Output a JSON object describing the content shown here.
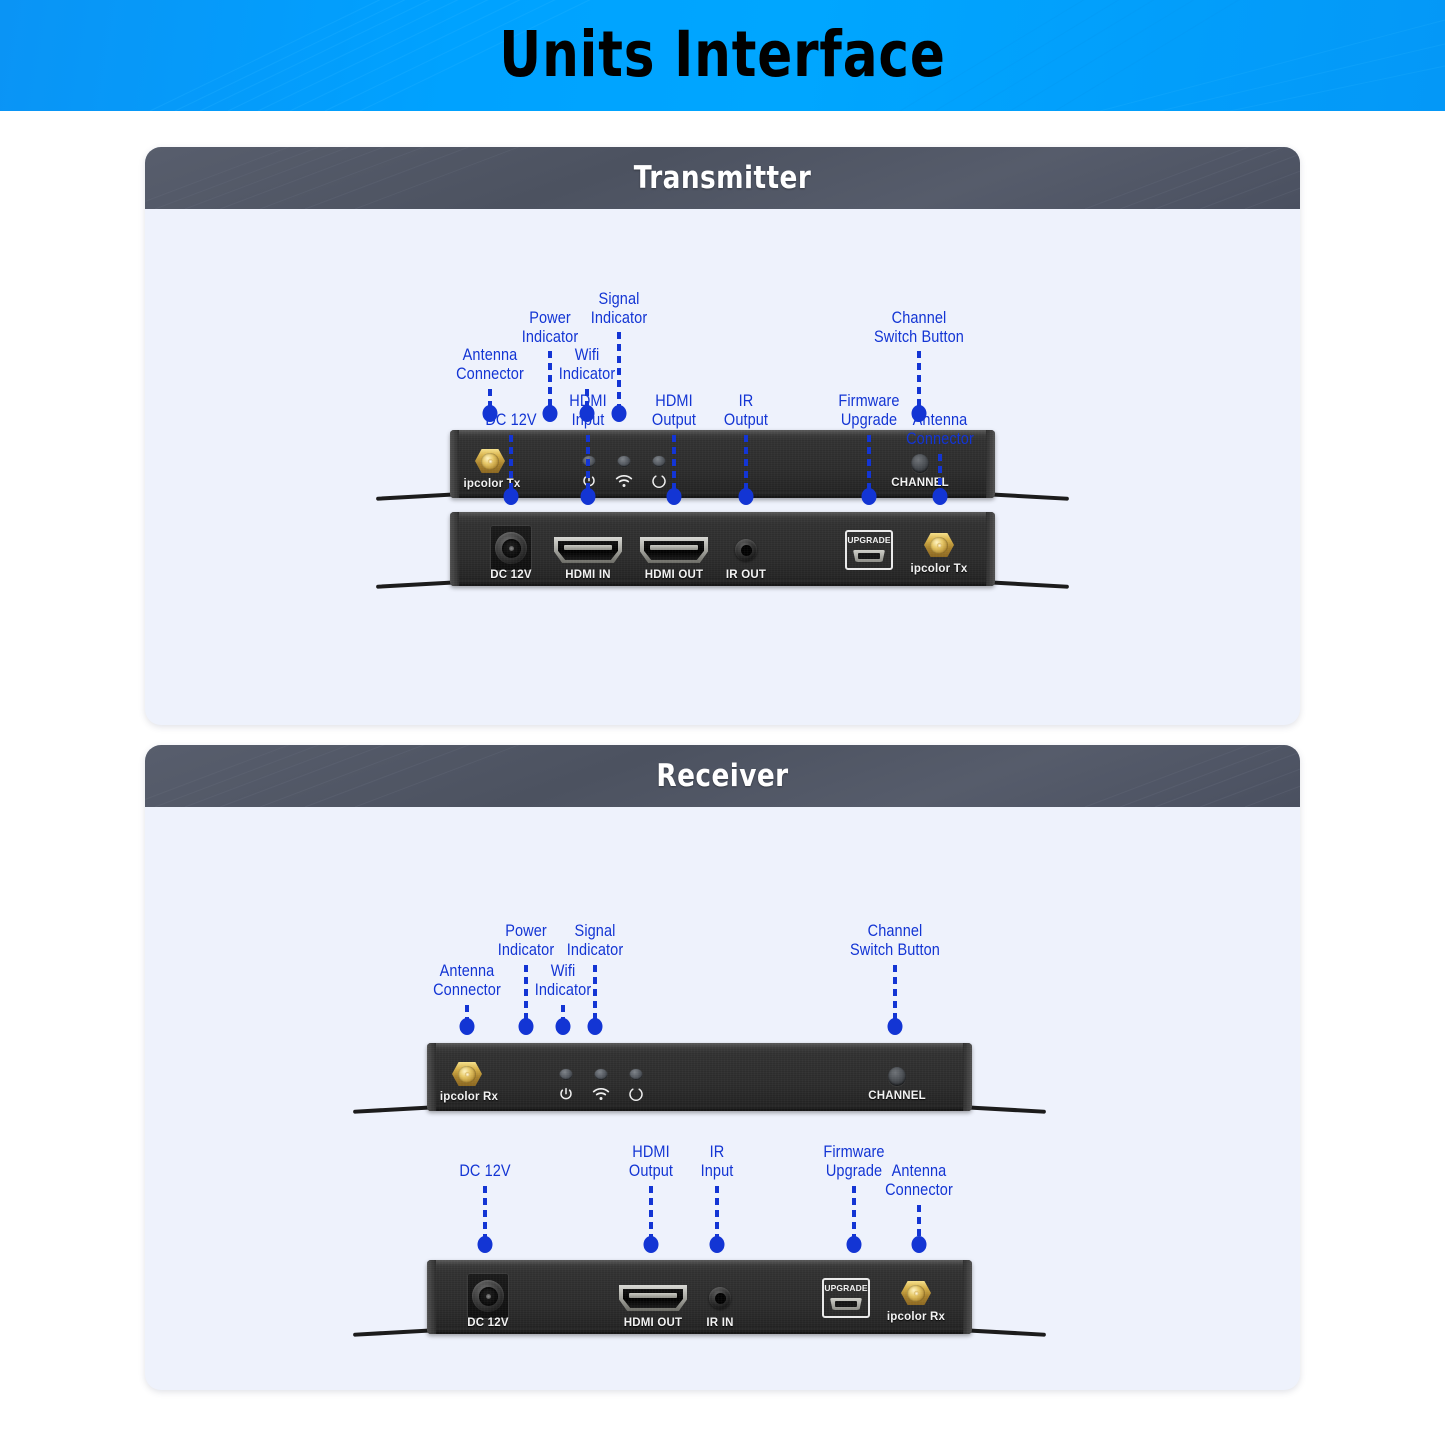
{
  "banner": {
    "title": "Units Interface",
    "bg_color": "#00a2ff",
    "title_color": "#000000"
  },
  "theme": {
    "card_bg": "#eef2fc",
    "card_header_bg": "#4e5463",
    "callout_color": "#1335d4",
    "device_body": "#2b2b2b",
    "connector_gold": "#d8b24a"
  },
  "sections": [
    {
      "id": "transmitter",
      "title": "Transmitter",
      "front": {
        "device_brand": "ipcolor Tx",
        "button_label": "CHANNEL",
        "icons": [
          "power-icon",
          "wifi-icon",
          "signal-icon"
        ],
        "callouts": [
          {
            "label": "Antenna\nConnector"
          },
          {
            "label": "Power\nIndicator"
          },
          {
            "label": "Wifi\nIndicator"
          },
          {
            "label": "Signal\nIndicator"
          },
          {
            "label": "Channel\nSwitch Button"
          }
        ]
      },
      "rear": {
        "device_brand": "ipcolor Tx",
        "port_labels": [
          "DC 12V",
          "HDMI IN",
          "HDMI OUT",
          "IR OUT"
        ],
        "upgrade_label": "UPGRADE",
        "callouts": [
          {
            "label": "DC 12V"
          },
          {
            "label": "HDMI\nInput"
          },
          {
            "label": "HDMI\nOutput"
          },
          {
            "label": "IR\nOutput"
          },
          {
            "label": "Firmware\nUpgrade"
          },
          {
            "label": "Antenna\nConnector"
          }
        ]
      }
    },
    {
      "id": "receiver",
      "title": "Receiver",
      "front": {
        "device_brand": "ipcolor Rx",
        "button_label": "CHANNEL",
        "icons": [
          "power-icon",
          "wifi-icon",
          "signal-icon"
        ],
        "callouts": [
          {
            "label": "Antenna\nConnector"
          },
          {
            "label": "Power\nIndicator"
          },
          {
            "label": "Wifi\nIndicator"
          },
          {
            "label": "Signal\nIndicator"
          },
          {
            "label": "Channel\nSwitch Button"
          }
        ]
      },
      "rear": {
        "device_brand": "ipcolor Rx",
        "port_labels": [
          "DC 12V",
          "HDMI OUT",
          "IR IN"
        ],
        "upgrade_label": "UPGRADE",
        "callouts": [
          {
            "label": "DC 12V"
          },
          {
            "label": "HDMI\nOutput"
          },
          {
            "label": "IR\nInput"
          },
          {
            "label": "Firmware\nUpgrade"
          },
          {
            "label": "Antenna\nConnector"
          }
        ]
      }
    }
  ]
}
